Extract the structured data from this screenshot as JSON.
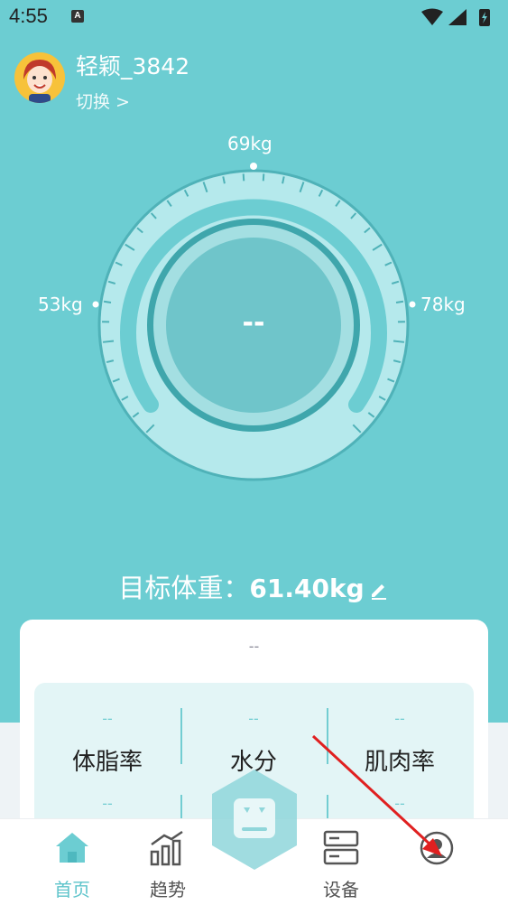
{
  "status_bar": {
    "time": "4:55",
    "notification_icon": "A"
  },
  "profile": {
    "username": "轻颖_3842",
    "switch_label": "切换 >"
  },
  "gauge": {
    "label_top": "69kg",
    "label_left": "53kg",
    "label_right": "78kg",
    "current_value": "--"
  },
  "target": {
    "label": "目标体重：",
    "value": "61.40kg"
  },
  "card": {
    "top_value": "--",
    "metrics": [
      {
        "value": "--",
        "label": "体脂率"
      },
      {
        "value": "--",
        "label": "水分"
      },
      {
        "value": "--",
        "label": "肌肉率"
      },
      {
        "value": "--",
        "label": ""
      },
      {
        "value": "--",
        "label": ""
      },
      {
        "value": "--",
        "label": ""
      }
    ]
  },
  "nav": {
    "home": "首页",
    "trend": "趋势",
    "device": "设备"
  },
  "colors": {
    "background": "#6ccdd2",
    "accent": "#5ec4cb",
    "annotation_arrow": "#e02020"
  }
}
